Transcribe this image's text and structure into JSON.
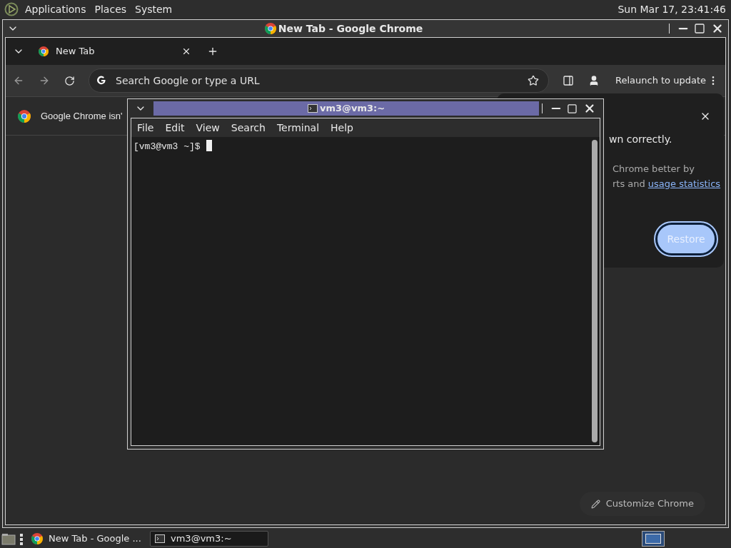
{
  "top_panel": {
    "menus": [
      "Applications",
      "Places",
      "System"
    ],
    "clock": "Sun Mar 17, 23:41:46"
  },
  "chrome": {
    "title": "New Tab - Google Chrome",
    "tab": {
      "label": "New Tab"
    },
    "omnibox": {
      "placeholder": "Search Google or type a URL"
    },
    "relaunch": "Relaunch to update",
    "infobar": "Google Chrome isn'",
    "popup": {
      "lines": [
        "wn correctly.",
        "Chrome better by"
      ],
      "text": "rts and",
      "link": "usage statistics",
      "button": "Restore"
    },
    "customize": "Customize Chrome"
  },
  "terminal": {
    "title": "vm3@vm3:~",
    "menus": [
      "File",
      "Edit",
      "View",
      "Search",
      "Terminal",
      "Help"
    ],
    "prompt": "[vm3@vm3 ~]$"
  },
  "taskbar": {
    "items": [
      {
        "label": "New Tab - Google ...",
        "kind": "chrome",
        "selected": false
      },
      {
        "label": "vm3@vm3:~",
        "kind": "terminal",
        "selected": true
      }
    ]
  }
}
